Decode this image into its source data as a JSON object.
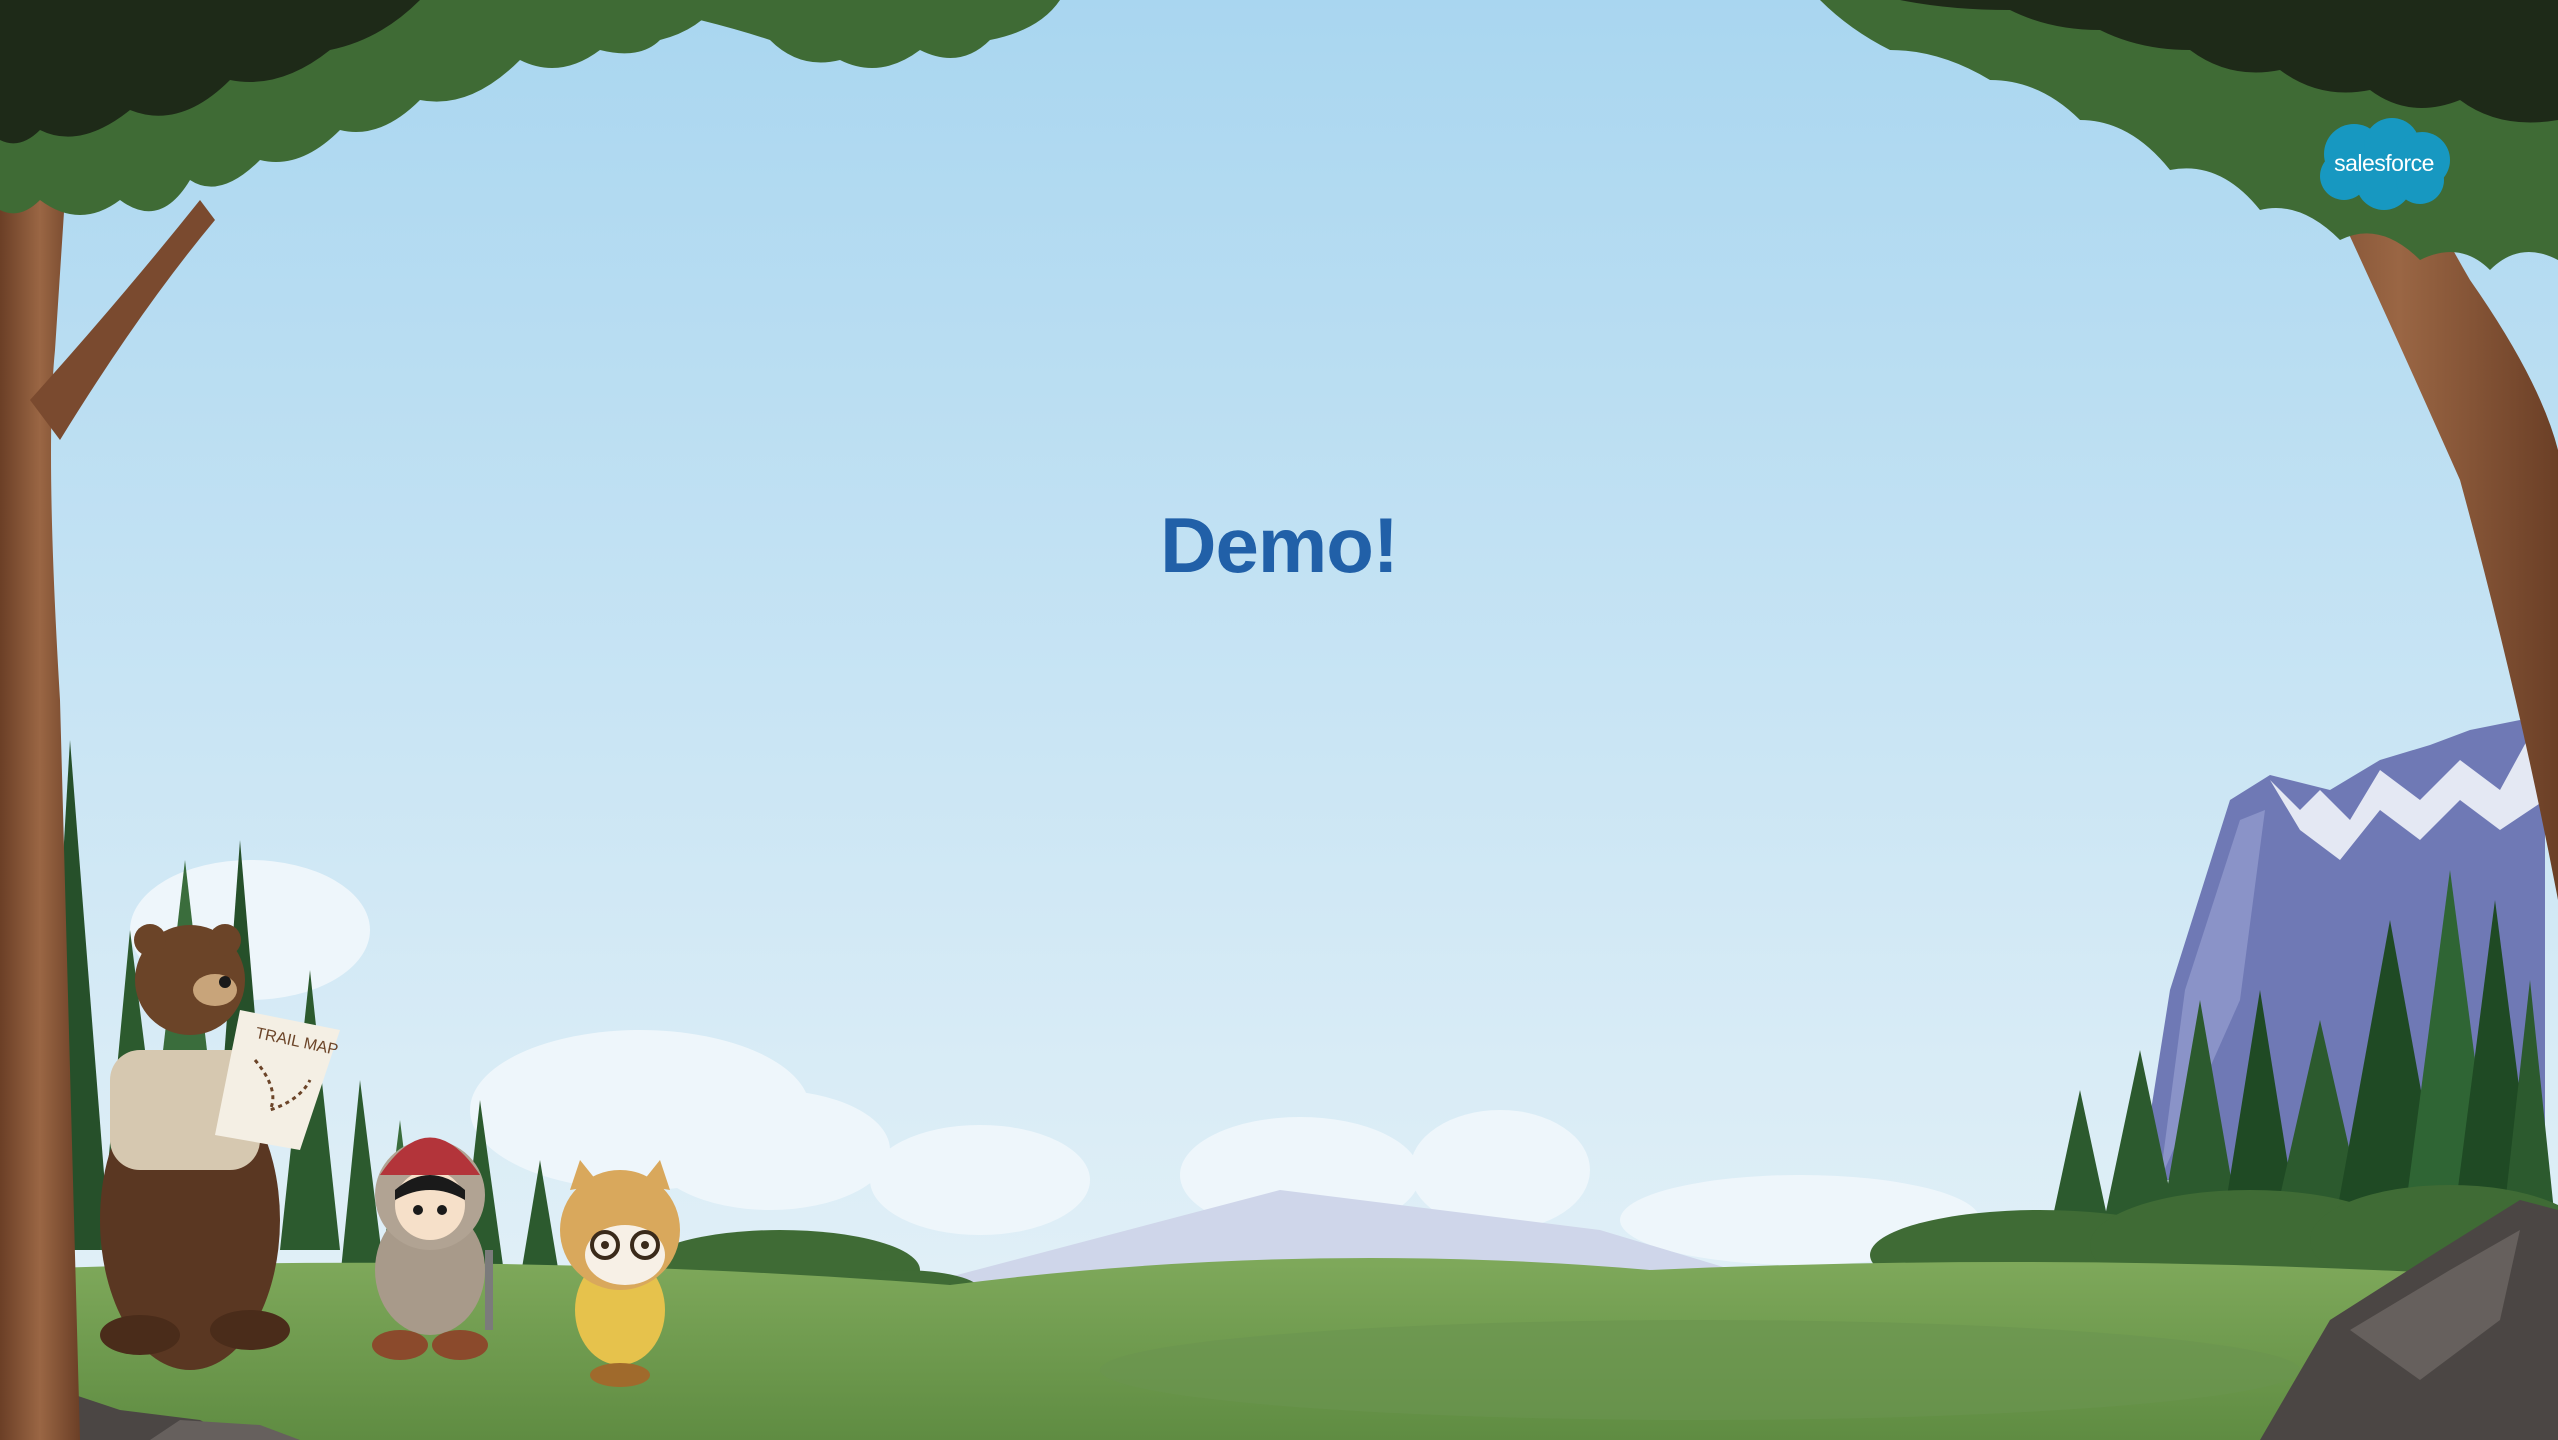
{
  "slide": {
    "title": "Demo!",
    "logo_text": "salesforce",
    "trail_map_text": "TRAIL MAP"
  },
  "colors": {
    "title": "#2160a8",
    "sky_top": "#a9d6f0",
    "sky_bottom": "#e6f2f8",
    "grass": "#6f9a4e",
    "logo_blue": "#1798c1",
    "tree_trunk": "#8a5a3b",
    "foliage": "#3f6b35",
    "mountain": "#6f79b5"
  },
  "icons": [
    "salesforce-cloud-logo",
    "bear-mascot",
    "astro-mascot",
    "ocelot-mascot",
    "trail-map"
  ]
}
